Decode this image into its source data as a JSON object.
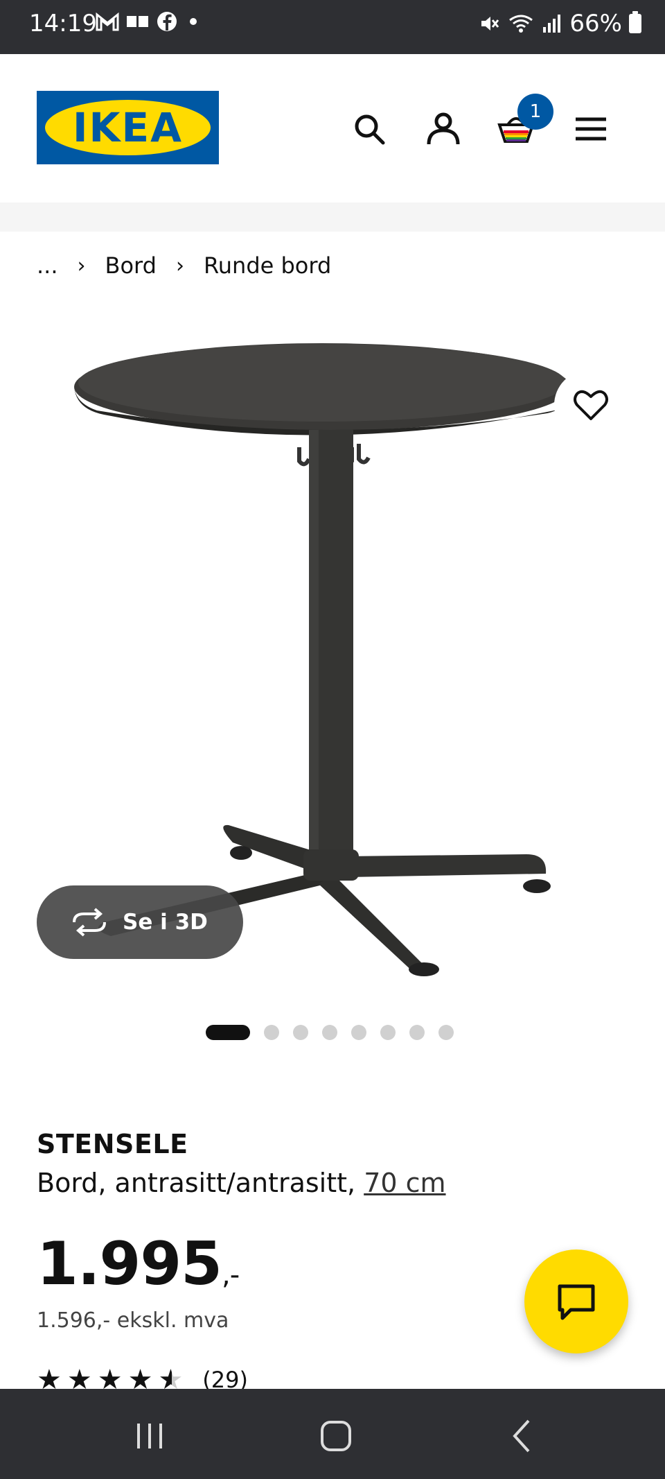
{
  "status_bar": {
    "time": "14:19",
    "battery": "66%",
    "left_icons": [
      "gmail-icon",
      "media-icon",
      "facebook-icon",
      "dot-icon"
    ],
    "right_icons": [
      "mute-icon",
      "wifi-icon",
      "signal-icon",
      "battery-icon"
    ]
  },
  "header": {
    "logo_text": "IKEA",
    "icons": [
      "search-icon",
      "account-icon",
      "basket-icon",
      "menu-icon"
    ],
    "cart_count": "1"
  },
  "breadcrumb": {
    "ellipsis": "...",
    "items": [
      "Bord",
      "Runde bord"
    ]
  },
  "gallery": {
    "see_3d_label": "Se i 3D",
    "total_images": 8,
    "active_index": 0
  },
  "product": {
    "name": "STENSELE",
    "description": "Bord, antrasitt/antrasitt, ",
    "size_link": "70 cm",
    "price": "1.995",
    "price_suffix": ",-",
    "price_ex_vat": "1.596,- ekskl. mva",
    "rating": 4.5,
    "review_count": "(29)"
  },
  "colors": {
    "ikea_blue": "#0058a3",
    "ikea_yellow": "#ffdb00",
    "system_bar": "#2e2f33"
  }
}
